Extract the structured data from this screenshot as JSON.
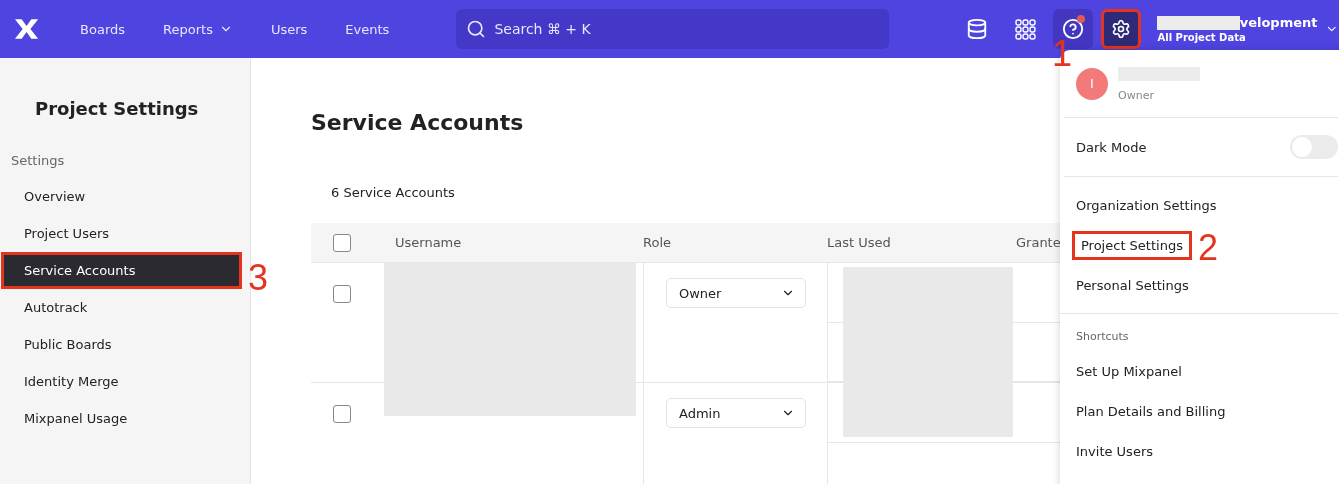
{
  "topbar": {
    "nav": [
      {
        "label": "Boards",
        "has_menu": false
      },
      {
        "label": "Reports",
        "has_menu": true
      },
      {
        "label": "Users",
        "has_menu": false
      },
      {
        "label": "Events",
        "has_menu": false
      }
    ],
    "search": {
      "placeholder": "Search ⌘ + K"
    },
    "help": {
      "notification": true
    },
    "settings": {
      "highlighted": true,
      "callout": "1"
    },
    "project": {
      "name": "velopment",
      "scope": "All Project Data"
    }
  },
  "sidebar": {
    "title": "Project Settings",
    "section": "Settings",
    "items": [
      {
        "label": "Overview",
        "selected": false,
        "highlighted": false
      },
      {
        "label": "Project Users",
        "selected": false,
        "highlighted": false
      },
      {
        "label": "Service Accounts",
        "selected": true,
        "highlighted": true,
        "callout": "3"
      },
      {
        "label": "Autotrack",
        "selected": false,
        "highlighted": false
      },
      {
        "label": "Public Boards",
        "selected": false,
        "highlighted": false
      },
      {
        "label": "Identity Merge",
        "selected": false,
        "highlighted": false
      },
      {
        "label": "Mixpanel Usage",
        "selected": false,
        "highlighted": false
      }
    ]
  },
  "main": {
    "title": "Service Accounts",
    "count": "6 Service Accounts",
    "table": {
      "columns": [
        "Username",
        "Role",
        "Last Used",
        "Grante"
      ],
      "header_checked": false,
      "rows": [
        {
          "checked": false,
          "role": "Owner"
        },
        {
          "checked": false,
          "role": "Admin"
        }
      ]
    }
  },
  "menu": {
    "user": {
      "initial": "I",
      "role": "Owner"
    },
    "dark_mode": {
      "label": "Dark Mode",
      "on": false
    },
    "settings": [
      {
        "label": "Organization Settings",
        "highlighted": false
      },
      {
        "label": "Project Settings",
        "highlighted": true,
        "callout": "2"
      },
      {
        "label": "Personal Settings",
        "highlighted": false
      }
    ],
    "shortcuts_title": "Shortcuts",
    "shortcuts": [
      "Set Up Mixpanel",
      "Plan Details and Billing",
      "Invite Users"
    ]
  }
}
